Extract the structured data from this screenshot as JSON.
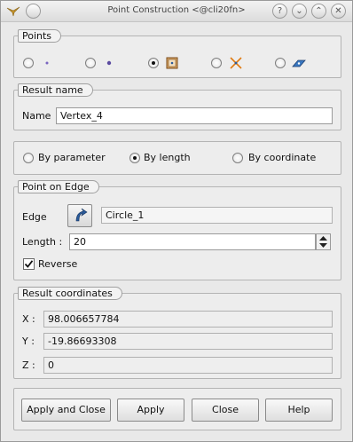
{
  "window": {
    "title": "Point Construction <@cli20fn>"
  },
  "titlebar": {
    "help_glyph": "?",
    "min_glyph": "⌄",
    "max_glyph": "⌃",
    "close_glyph": "✕"
  },
  "points": {
    "title": "Points",
    "options": [
      {
        "name": "by-xyz",
        "checked": false
      },
      {
        "name": "by-reference",
        "checked": false
      },
      {
        "name": "on-edge",
        "checked": true
      },
      {
        "name": "intersection",
        "checked": false
      },
      {
        "name": "on-face",
        "checked": false
      }
    ]
  },
  "result_name": {
    "title": "Result name",
    "label": "Name",
    "value": "Vertex_4"
  },
  "mode": {
    "by_parameter": "By parameter",
    "by_length": "By length",
    "by_coordinate": "By coordinate",
    "selected": "by_length"
  },
  "edge_section": {
    "title": "Point on Edge",
    "edge_label": "Edge",
    "edge_value": "Circle_1",
    "length_label": "Length :",
    "length_value": "20",
    "reverse_label": "Reverse",
    "reverse_checked": true
  },
  "result_coords": {
    "title": "Result coordinates",
    "x_label": "X :",
    "x_value": "98.006657784",
    "y_label": "Y :",
    "y_value": "-19.86693308",
    "z_label": "Z :",
    "z_value": "0"
  },
  "buttons": {
    "apply_close": "Apply and Close",
    "apply": "Apply",
    "close": "Close",
    "help": "Help"
  },
  "colors": {
    "accent": "#2a5a9a",
    "orange": "#e07a10"
  }
}
